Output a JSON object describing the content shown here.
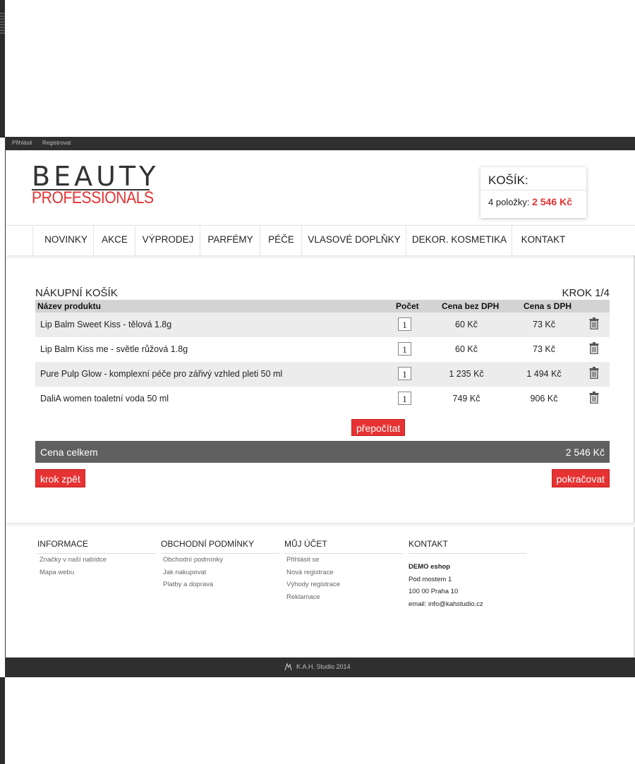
{
  "topbar": {
    "login": "Přihlásit",
    "register": "Registrovat"
  },
  "logo": {
    "line1": "BEAUTY",
    "line2": "PROFESSIONALS"
  },
  "cart_widget": {
    "title": "KOŠÍK:",
    "count_label": "4 položky:",
    "sum": "2 546 Kč"
  },
  "nav": {
    "items": [
      "NOVINKY",
      "AKCE",
      "VÝPRODEJ",
      "PARFÉMY",
      "PÉČE",
      "VLASOVÉ DOPLŇKY",
      "DEKOR. KOSMETIKA",
      "KONTAKT"
    ]
  },
  "cart": {
    "title": "NÁKUPNÍ KOŠÍK",
    "step": "KROK 1/4",
    "columns": {
      "name": "Název produktu",
      "qty": "Počet",
      "net": "Cena bez DPH",
      "gross": "Cena s DPH"
    },
    "rows": [
      {
        "name": "Lip Balm Sweet Kiss - tělová 1.8g",
        "qty": "1",
        "net": "60 Kč",
        "gross": "73 Kč"
      },
      {
        "name": "Lip Balm Kiss me - světle růžová 1.8g",
        "qty": "1",
        "net": "60 Kč",
        "gross": "73 Kč"
      },
      {
        "name": "Pure Pulp Glow - komplexní péče pro zářivý vzhled pleti 50 ml",
        "qty": "1",
        "net": "1 235 Kč",
        "gross": "1 494 Kč"
      },
      {
        "name": "DaliA women toaletní voda 50 ml",
        "qty": "1",
        "net": "749 Kč",
        "gross": "906 Kč"
      }
    ],
    "recalc_label": "přepočítat",
    "total_label": "Cena celkem",
    "total_value": "2 546 Kč",
    "back_label": "krok zpět",
    "continue_label": "pokračovat"
  },
  "footer": {
    "info": {
      "heading": "INFORMACE",
      "links": [
        "Značky v naší nabídce",
        "Mapa webu"
      ]
    },
    "terms": {
      "heading": "OBCHODNÍ PODMÍNKY",
      "links": [
        "Obchodní podmínky",
        "Jak nakupovat",
        "Platby a doprava"
      ]
    },
    "account": {
      "heading": "MŮJ ÚČET",
      "links": [
        "Přihlásit se",
        "Nová registrace",
        "Výhody registrace",
        "Reklamace"
      ]
    },
    "contact": {
      "heading": "KONTAKT",
      "company": "DEMO eshop",
      "street": "Pod mostem 1",
      "city": "100 00 Praha 10",
      "email": "email: info@kahstudio.cz"
    }
  },
  "copyright": "K.A.H. Studio 2014",
  "colors": {
    "accent": "#e63232",
    "dark": "#2f2f2f",
    "total_bar": "#606060"
  }
}
